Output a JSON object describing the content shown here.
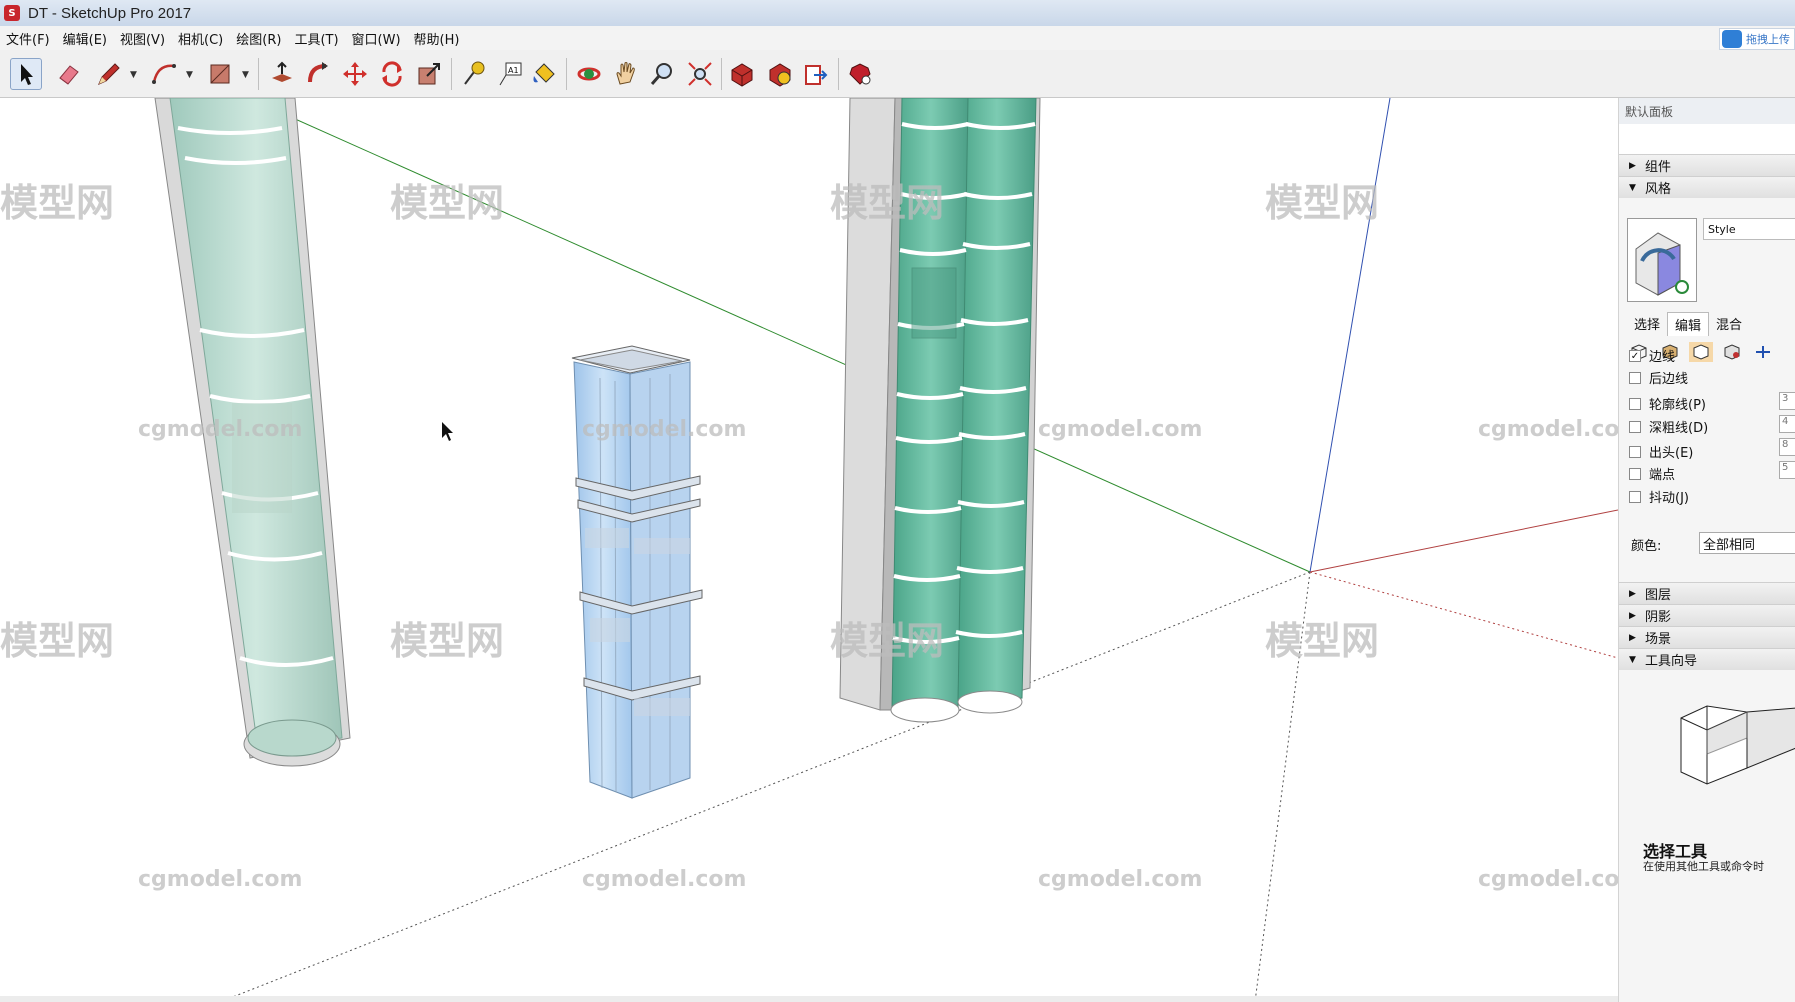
{
  "window": {
    "title": "DT - SketchUp Pro 2017",
    "icon": "sketchup-logo-icon"
  },
  "menu": [
    {
      "label": "文件(F)"
    },
    {
      "label": "编辑(E)"
    },
    {
      "label": "视图(V)"
    },
    {
      "label": "相机(C)"
    },
    {
      "label": "绘图(R)"
    },
    {
      "label": "工具(T)"
    },
    {
      "label": "窗口(W)"
    },
    {
      "label": "帮助(H)"
    }
  ],
  "upload_button": {
    "label": "拖拽上传",
    "icon": "cloud-upload-icon"
  },
  "toolbar": {
    "tools": [
      {
        "name": "select-tool",
        "icon": "arrow-cursor-icon",
        "active": true
      },
      {
        "name": "eraser-tool",
        "icon": "eraser-icon"
      },
      {
        "name": "line-tool",
        "icon": "pencil-icon"
      },
      {
        "name": "arc-tool",
        "icon": "arc-icon"
      },
      {
        "name": "rectangle-tool",
        "icon": "rectangle-icon"
      },
      {
        "name": "push-pull-tool",
        "icon": "push-pull-icon"
      },
      {
        "name": "follow-me-tool",
        "icon": "follow-me-icon"
      },
      {
        "name": "move-tool",
        "icon": "move-arrows-icon"
      },
      {
        "name": "rotate-tool",
        "icon": "rotate-icon"
      },
      {
        "name": "scale-tool",
        "icon": "scale-icon"
      },
      {
        "name": "tape-measure-tool",
        "icon": "tape-measure-icon"
      },
      {
        "name": "text-tool",
        "icon": "text-label-icon",
        "glyph": "A1"
      },
      {
        "name": "paint-bucket-tool",
        "icon": "paint-bucket-icon"
      },
      {
        "name": "orbit-tool",
        "icon": "orbit-icon"
      },
      {
        "name": "pan-tool",
        "icon": "hand-icon"
      },
      {
        "name": "zoom-tool",
        "icon": "magnifier-icon"
      },
      {
        "name": "zoom-extents-tool",
        "icon": "zoom-extents-icon"
      },
      {
        "name": "warehouse-tool",
        "icon": "3d-warehouse-icon"
      },
      {
        "name": "extension-warehouse-tool",
        "icon": "extension-warehouse-icon"
      },
      {
        "name": "layout-send-tool",
        "icon": "send-to-layout-icon"
      },
      {
        "name": "ruby-console-tool",
        "icon": "ruby-gem-icon"
      }
    ]
  },
  "tray": {
    "title": "默认面板",
    "sections_top": [
      {
        "label": "组件",
        "expanded": false
      },
      {
        "label": "风格",
        "expanded": true
      }
    ],
    "style_name": "Style",
    "tabs": [
      {
        "label": "选择"
      },
      {
        "label": "编辑",
        "active": true
      },
      {
        "label": "混合"
      }
    ],
    "edge_options": [
      {
        "label": "边线",
        "checked": true,
        "value": ""
      },
      {
        "label": "后边线",
        "checked": false,
        "value": ""
      },
      {
        "label": "轮廓线(P)",
        "checked": false,
        "value": "3"
      },
      {
        "label": "深粗线(D)",
        "checked": false,
        "value": "4"
      },
      {
        "label": "出头(E)",
        "checked": false,
        "value": "8"
      },
      {
        "label": "端点",
        "checked": false,
        "value": "5"
      },
      {
        "label": "抖动(J)",
        "checked": false,
        "value": ""
      }
    ],
    "color_label": "颜色:",
    "color_value": "全部相同",
    "sections_bottom": [
      {
        "label": "图层",
        "expanded": false
      },
      {
        "label": "阴影",
        "expanded": false
      },
      {
        "label": "场景",
        "expanded": false
      },
      {
        "label": "工具向导",
        "expanded": true
      }
    ],
    "tool_guide": {
      "title": "选择工具",
      "description": "在使用其他工具或命令时"
    }
  },
  "watermarks": {
    "logo_text": "模型网",
    "site_text": "cgmodel.com"
  },
  "colors": {
    "axis_green": "#2e8b2e",
    "axis_red": "#b04040",
    "axis_blue": "#3050b0",
    "elevator_teal": "#6fbfa8",
    "glass_blue": "#a9cdef"
  }
}
